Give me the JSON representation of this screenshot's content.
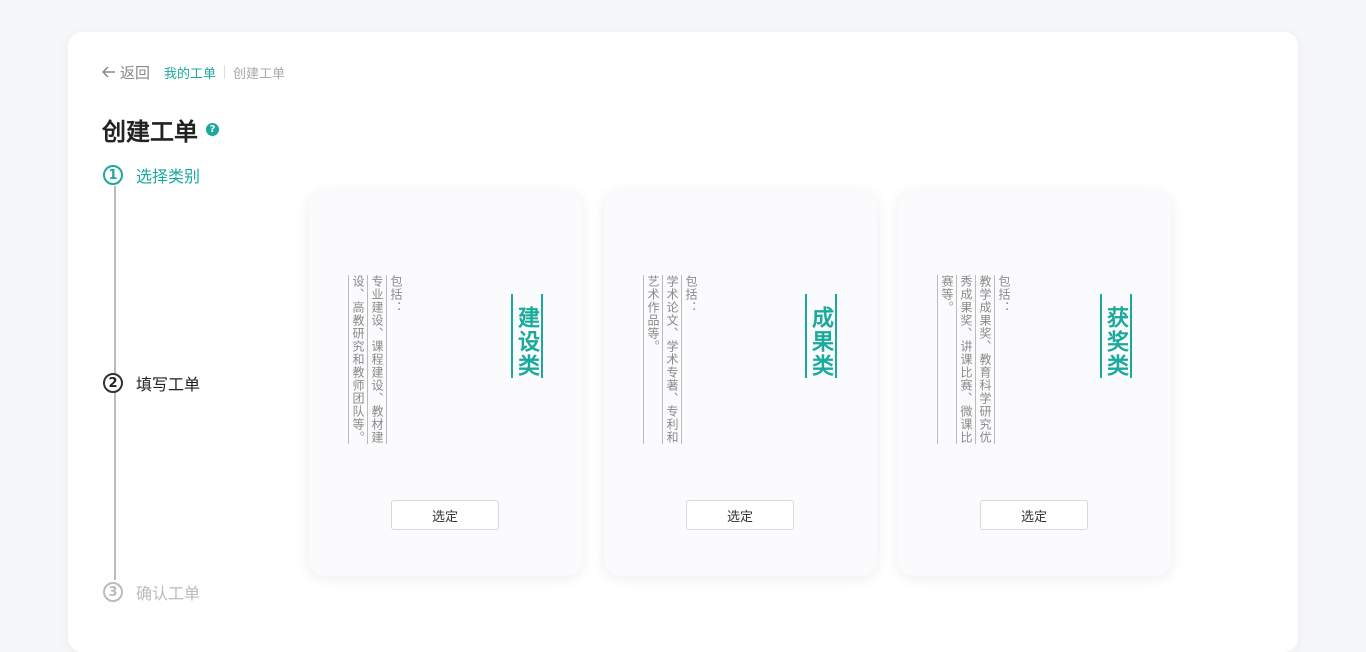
{
  "breadcrumb": {
    "back_label": "返回",
    "my_orders": "我的工单",
    "current": "创建工单"
  },
  "page": {
    "title": "创建工单",
    "help_icon": "question-icon",
    "help_glyph": "?"
  },
  "steps": [
    {
      "number": "1",
      "label": "选择类别",
      "state": "active"
    },
    {
      "number": "2",
      "label": "填写工单",
      "state": "pending"
    },
    {
      "number": "3",
      "label": "确认工单",
      "state": "disabled"
    }
  ],
  "cards": [
    {
      "title": "建设类",
      "desc_label": "包括：",
      "desc_lines": [
        "专业建设、课程建设、教材建",
        "设、高教研究和教师团队等。"
      ],
      "button": "选定"
    },
    {
      "title": "成果类",
      "desc_label": "包括：",
      "desc_lines": [
        "学术论文、学术专著、专利和",
        "艺术作品等。"
      ],
      "button": "选定"
    },
    {
      "title": "获奖类",
      "desc_label": "包括：",
      "desc_lines": [
        "教学成果奖、教育科学研究优",
        "秀成果奖、讲课比赛、微课比",
        "赛等。"
      ],
      "button": "选定"
    }
  ],
  "colors": {
    "accent": "#1aaa9b",
    "text": "#333333",
    "muted": "#8a8a8a"
  }
}
